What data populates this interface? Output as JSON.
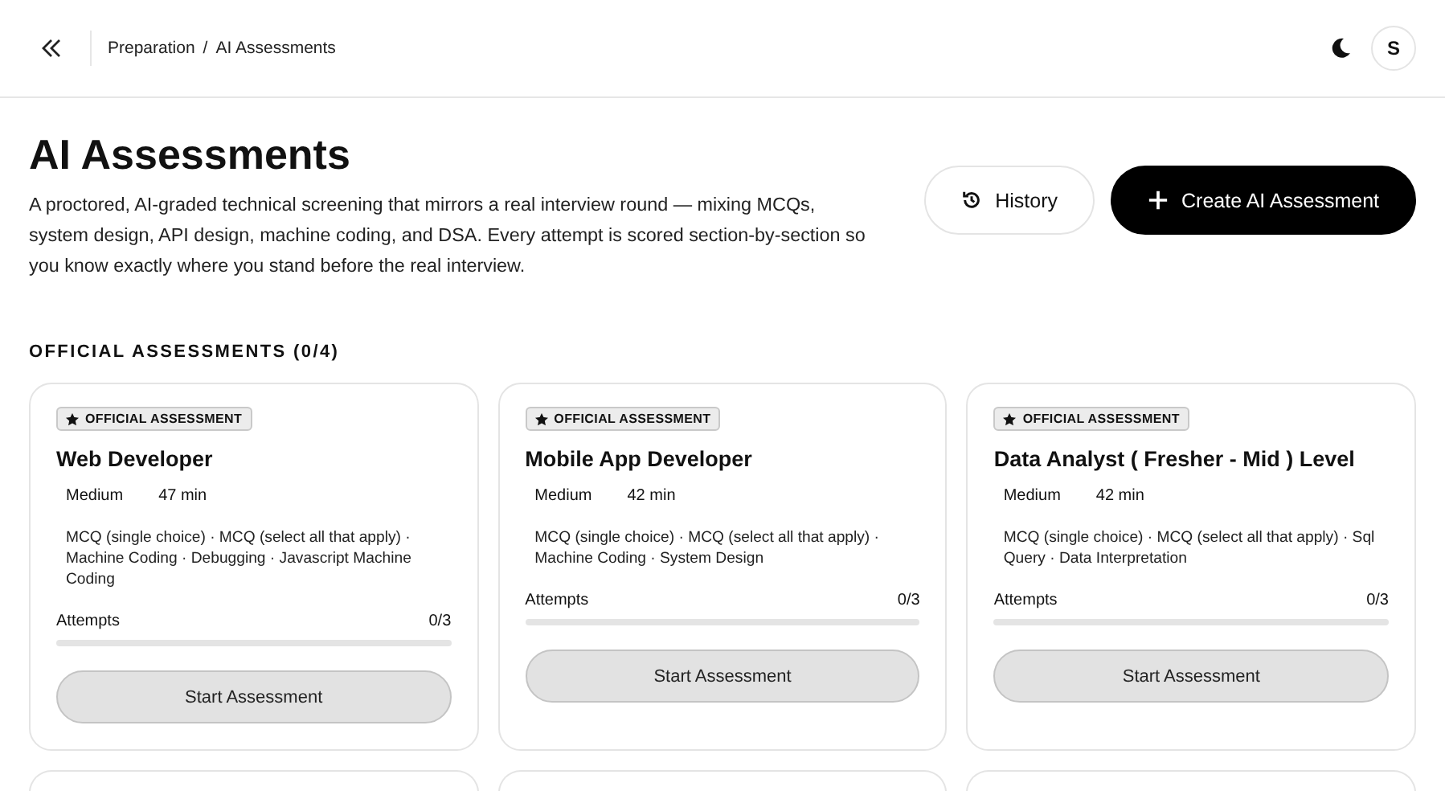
{
  "header": {
    "breadcrumb": [
      {
        "label": "Preparation"
      },
      {
        "label": "AI Assessments"
      }
    ],
    "separator": "/",
    "avatar": "S"
  },
  "intro": {
    "title": "AI Assessments",
    "description": "A proctored, AI-graded technical screening that mirrors a real interview round — mixing MCQs, system design, API design, machine coding, and DSA. Every attempt is scored section-by-section so you know exactly where you stand before the real interview.",
    "buttons": [
      {
        "kind": "secondary",
        "label": "History"
      },
      {
        "kind": "primary",
        "label": "Create AI Assessment"
      }
    ]
  },
  "section": {
    "title": "OFFICIAL ASSESSMENTS (0/4)"
  },
  "cards": [
    {
      "badge": "OFFICIAL ASSESSMENT",
      "title": "Web Developer",
      "difficulty": "Medium",
      "duration": "47 min",
      "topics": "MCQ (single choice) · MCQ (select all that apply) · Machine Coding · Debugging · Javascript Machine Coding",
      "attempts_label": "Attempts",
      "attempts": "0/3",
      "level": 0,
      "button": "Start Assessment"
    },
    {
      "badge": "OFFICIAL ASSESSMENT",
      "title": "Mobile App Developer",
      "difficulty": "Medium",
      "duration": "42 min",
      "topics": "MCQ (single choice) · MCQ (select all that apply) · Machine Coding · System Design",
      "attempts_label": "Attempts",
      "attempts": "0/3",
      "level": 0,
      "button": "Start Assessment"
    },
    {
      "badge": "OFFICIAL ASSESSMENT",
      "title": "Data Analyst ( Fresher - Mid ) Level",
      "difficulty": "Medium",
      "duration": "42 min",
      "topics": "MCQ (single choice) · MCQ (select all that apply) · Sql Query · Data Interpretation",
      "attempts_label": "Attempts",
      "attempts": "0/3",
      "level": 0,
      "button": "Start Assessment"
    }
  ]
}
